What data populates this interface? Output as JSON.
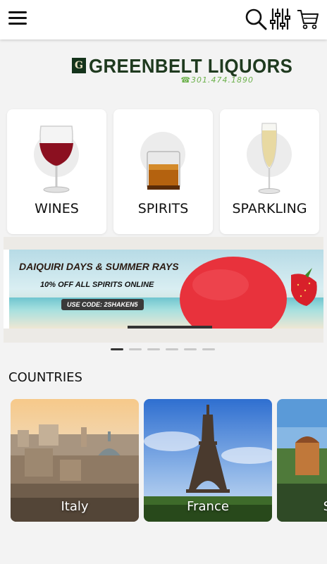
{
  "header": {
    "menu_icon": "hamburger-menu-icon",
    "search_icon": "search-icon",
    "filter_icon": "sliders-filter-icon",
    "cart_icon": "shopping-cart-icon"
  },
  "brand": {
    "logo_letter": "G",
    "name": "GREENBELT LIQUORS",
    "phone": "☎301.474.1890",
    "colors": {
      "primary": "#1f3a1f",
      "phone": "#6bb04a"
    }
  },
  "categories": [
    {
      "label": "WINES",
      "icon": "red-wine-glass"
    },
    {
      "label": "SPIRITS",
      "icon": "whiskey-glass"
    },
    {
      "label": "SPARKLING",
      "icon": "champagne-flute"
    }
  ],
  "banner": {
    "headline": "DAIQUIRI DAYS & SUMMER RAYS",
    "subline": "10% OFF ALL SPIRITS ONLINE",
    "code": "USE CODE: 2SHAKEN5",
    "slide_count": 6,
    "active_slide": 1
  },
  "countries_section": {
    "title": "COUNTRIES",
    "items": [
      {
        "name": "Italy"
      },
      {
        "name": "France"
      },
      {
        "name": "S"
      }
    ]
  }
}
